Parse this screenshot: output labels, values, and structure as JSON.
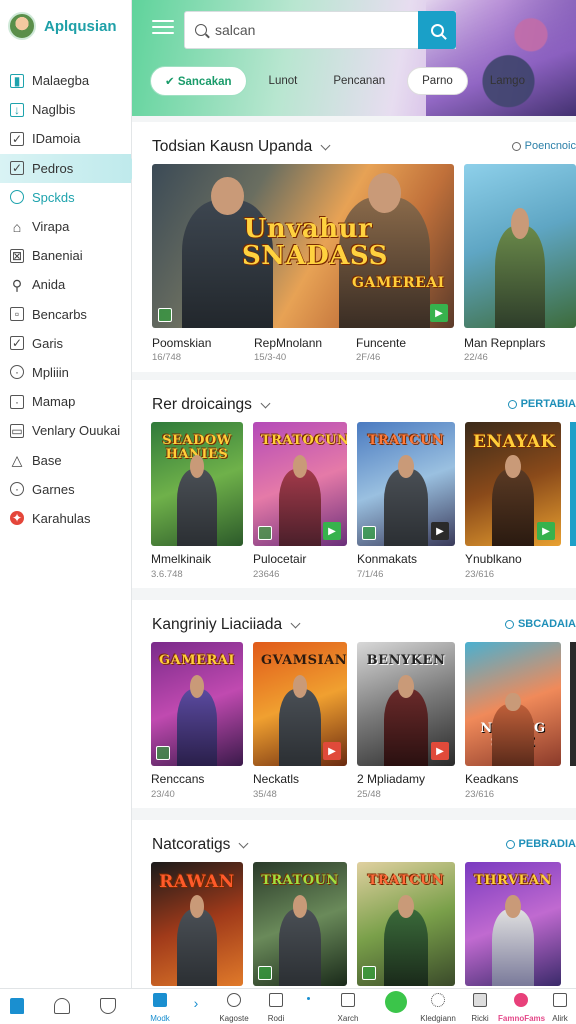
{
  "app": {
    "title": "Aplqusian"
  },
  "sidebar": {
    "items": [
      {
        "label": "Malaegba",
        "icon": "chart-icon"
      },
      {
        "label": "Naglbis",
        "icon": "download-icon"
      },
      {
        "label": "IDamoia",
        "icon": "checkbox-icon"
      },
      {
        "label": "Pedros",
        "icon": "check-square-icon"
      },
      {
        "label": "Spckds",
        "icon": "search-icon"
      },
      {
        "label": "Virapa",
        "icon": "home-icon"
      },
      {
        "label": "Baneniai",
        "icon": "grid-icon"
      },
      {
        "label": "Anida",
        "icon": "user-icon"
      },
      {
        "label": "Bencarbs",
        "icon": "calendar-icon"
      },
      {
        "label": "Garis",
        "icon": "check-square-icon"
      },
      {
        "label": "Mpliiin",
        "icon": "shield-icon"
      },
      {
        "label": "Mamap",
        "icon": "square-icon"
      },
      {
        "label": "Venlary Ouukai",
        "icon": "screen-icon"
      },
      {
        "label": "Base",
        "icon": "bell-icon"
      },
      {
        "label": "Garnes",
        "icon": "location-icon"
      },
      {
        "label": "Karahulas",
        "icon": "red-badge-icon"
      }
    ]
  },
  "header": {
    "search": {
      "value": "salcan"
    },
    "chips": [
      "Sancakan",
      "Lunot",
      "Pencanan",
      "Parno",
      "Lamgo"
    ]
  },
  "sections": [
    {
      "title": "Todsian Kausn Upanda",
      "link": "Poencnoic",
      "cards": [
        {
          "name": "Poomskian",
          "meta": "16/748",
          "logo": "Unvahur SNADASS"
        },
        {
          "name": "RepMnolann",
          "meta": "15/3-40",
          "logo": "GAMEREAI"
        },
        {
          "name": "Funcente",
          "meta": "2F/46"
        },
        {
          "name": "Man Repnplars",
          "meta": "22/46"
        }
      ]
    },
    {
      "title": "Rer droicaings",
      "link": "PERTABIA",
      "cards": [
        {
          "name": "Mmelkinaik",
          "meta": "3.6.748",
          "logo": "SEADOW HANIES"
        },
        {
          "name": "Pulocetair",
          "meta": "23646",
          "logo": "TRATOCUN"
        },
        {
          "name": "Konmakats",
          "meta": "7/1/46",
          "logo": "TRATCUN"
        },
        {
          "name": "Ynublkano",
          "meta": "23/616",
          "logo": "ENAYAK"
        }
      ]
    },
    {
      "title": "Kangriniy Liaciiada",
      "link": "SBCADAIA",
      "cards": [
        {
          "name": "Renccans",
          "meta": "23/40",
          "logo": "GAMERAI"
        },
        {
          "name": "Neckatls",
          "meta": "35/48",
          "logo": "GVAMSIAN"
        },
        {
          "name": "2 Mpliadamy",
          "meta": "25/48",
          "logo": "BENYKEN"
        },
        {
          "name": "Keadkans",
          "meta": "23/616",
          "logo": "NOEING SONE"
        }
      ]
    },
    {
      "title": "Natcoratigs",
      "link": "PEBRADIA",
      "cards": [
        {
          "name": "",
          "meta": "",
          "logo": "RAWAN"
        },
        {
          "name": "",
          "meta": "",
          "logo": "TRATOUN"
        },
        {
          "name": "",
          "meta": "",
          "logo": "TRATCUN"
        },
        {
          "name": "",
          "meta": "",
          "logo": "THRVEAN"
        }
      ]
    }
  ],
  "bottom_bar": {
    "items": [
      {
        "label": "Modk",
        "icon": "home-icon"
      },
      {
        "label": "",
        "icon": "chevron-right-icon"
      },
      {
        "label": "Kagoste",
        "icon": "clock-icon"
      },
      {
        "label": "Rodi",
        "icon": "calendar-icon"
      },
      {
        "label": "",
        "icon": "dot-icon"
      },
      {
        "label": "Xarch",
        "icon": "document-icon"
      },
      {
        "label": "",
        "icon": "x-circle-icon"
      },
      {
        "label": "Kledgiann",
        "icon": "sparkle-icon"
      },
      {
        "label": "Ricki",
        "icon": "gift-icon"
      },
      {
        "label": "FamnoFams",
        "icon": "avatar-icon"
      },
      {
        "label": "Alirk",
        "icon": "grid-icon"
      }
    ]
  },
  "colors": {
    "accent": "#1ea3ad",
    "search_button": "#1aa0c8",
    "link": "#1e8fb8",
    "play": "#37b24d"
  }
}
